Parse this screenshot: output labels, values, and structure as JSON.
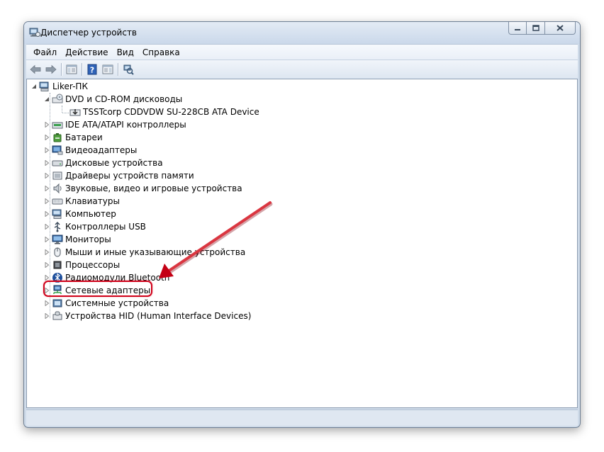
{
  "window": {
    "title": "Диспетчер устройств",
    "controls": {
      "minimize": "minimize-icon",
      "maximize": "maximize-icon",
      "close": "close-icon"
    }
  },
  "menubar": {
    "items": [
      {
        "label": "Файл"
      },
      {
        "label": "Действие"
      },
      {
        "label": "Вид"
      },
      {
        "label": "Справка"
      }
    ]
  },
  "toolbar": {
    "buttons": [
      "back-arrow-icon",
      "forward-arrow-icon",
      "console-tree-icon",
      "help-icon",
      "properties-icon",
      "scan-hardware-icon"
    ]
  },
  "tree": {
    "root": {
      "label": "Liker-ПК",
      "icon": "computer-icon"
    },
    "dvd": {
      "label": "DVD и CD-ROM дисководы",
      "icon": "dvd-drive-icon"
    },
    "dvd_child": {
      "label": "TSSTcorp CDDVDW SU-228CB ATA Device",
      "icon": "dvd-device-icon"
    },
    "items": [
      {
        "label": "IDE ATA/ATAPI контроллеры",
        "icon": "ide-controller-icon"
      },
      {
        "label": "Батареи",
        "icon": "battery-icon"
      },
      {
        "label": "Видеоадаптеры",
        "icon": "display-adapter-icon"
      },
      {
        "label": "Дисковые устройства",
        "icon": "disk-drive-icon"
      },
      {
        "label": "Драйверы устройств памяти",
        "icon": "storage-driver-icon"
      },
      {
        "label": "Звуковые, видео и игровые устройства",
        "icon": "speaker-icon"
      },
      {
        "label": "Клавиатуры",
        "icon": "keyboard-icon"
      },
      {
        "label": "Компьютер",
        "icon": "computer-icon"
      },
      {
        "label": "Контроллеры USB",
        "icon": "usb-icon"
      },
      {
        "label": "Мониторы",
        "icon": "monitor-icon"
      },
      {
        "label": "Мыши и иные указывающие устройства",
        "icon": "mouse-icon"
      },
      {
        "label": "Процессоры",
        "icon": "processor-icon"
      },
      {
        "label": "Радиомодули Bluetooth",
        "icon": "bluetooth-icon"
      },
      {
        "label": "Сетевые адаптеры",
        "icon": "network-adapter-icon"
      },
      {
        "label": "Системные устройства",
        "icon": "system-device-icon"
      },
      {
        "label": "Устройства HID (Human Interface Devices)",
        "icon": "hid-icon"
      }
    ]
  },
  "annotation": {
    "color": "#d0021b",
    "highlighted_item": "Сетевые адаптеры"
  }
}
